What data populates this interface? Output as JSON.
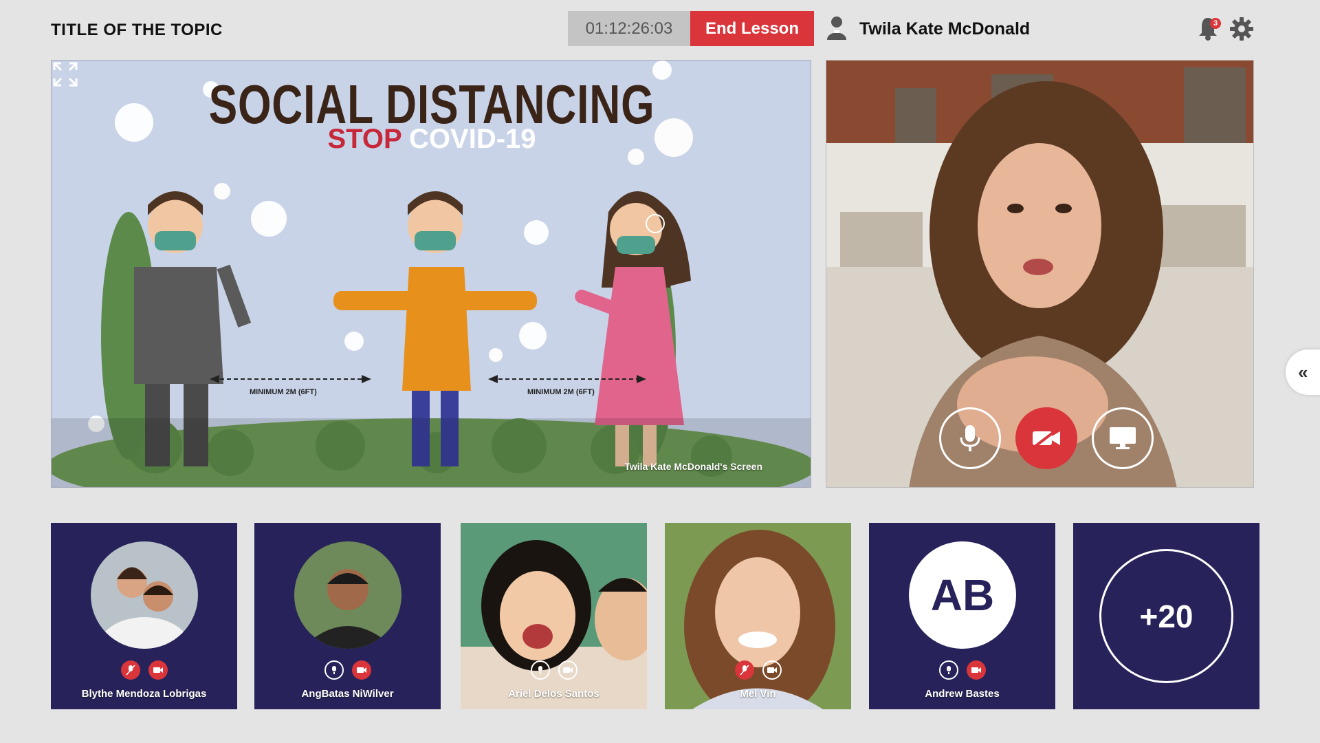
{
  "header": {
    "topic_title": "TITLE OF THE TOPIC",
    "timer": "01:12:26:03",
    "end_lesson_label": "End Lesson",
    "user_name": "Twila Kate McDonald",
    "notification_count": "3"
  },
  "shared_screen": {
    "poster_title": "SOCIAL DISTANCING",
    "poster_stop": "STOP",
    "poster_covid": "COVID-19",
    "distance_label_left": "MINIMUM 2M (6FT)",
    "distance_label_right": "MINIMUM 2M (6FT)",
    "owner_label": "Twila Kate McDonald's Screen"
  },
  "presenter": {
    "controls": [
      "mic-icon",
      "camera-off-icon",
      "screen-share-icon"
    ]
  },
  "participants": [
    {
      "name": "Blythe Mendoza Lobrigas",
      "mic": "muted",
      "cam": "off"
    },
    {
      "name": "AngBatas NiWilver",
      "mic": "on",
      "cam": "off"
    },
    {
      "name": "Ariel Delos Santos",
      "mic": "on",
      "cam": "on"
    },
    {
      "name": "Mel Vin",
      "mic": "muted",
      "cam": "on"
    },
    {
      "name": "Andrew Bastes",
      "initials": "AB",
      "mic": "on",
      "cam": "off"
    }
  ],
  "more_participants": "+20",
  "colors": {
    "accent_red": "#d9353b",
    "tile_navy": "#27235a",
    "background": "#e4e4e4"
  }
}
